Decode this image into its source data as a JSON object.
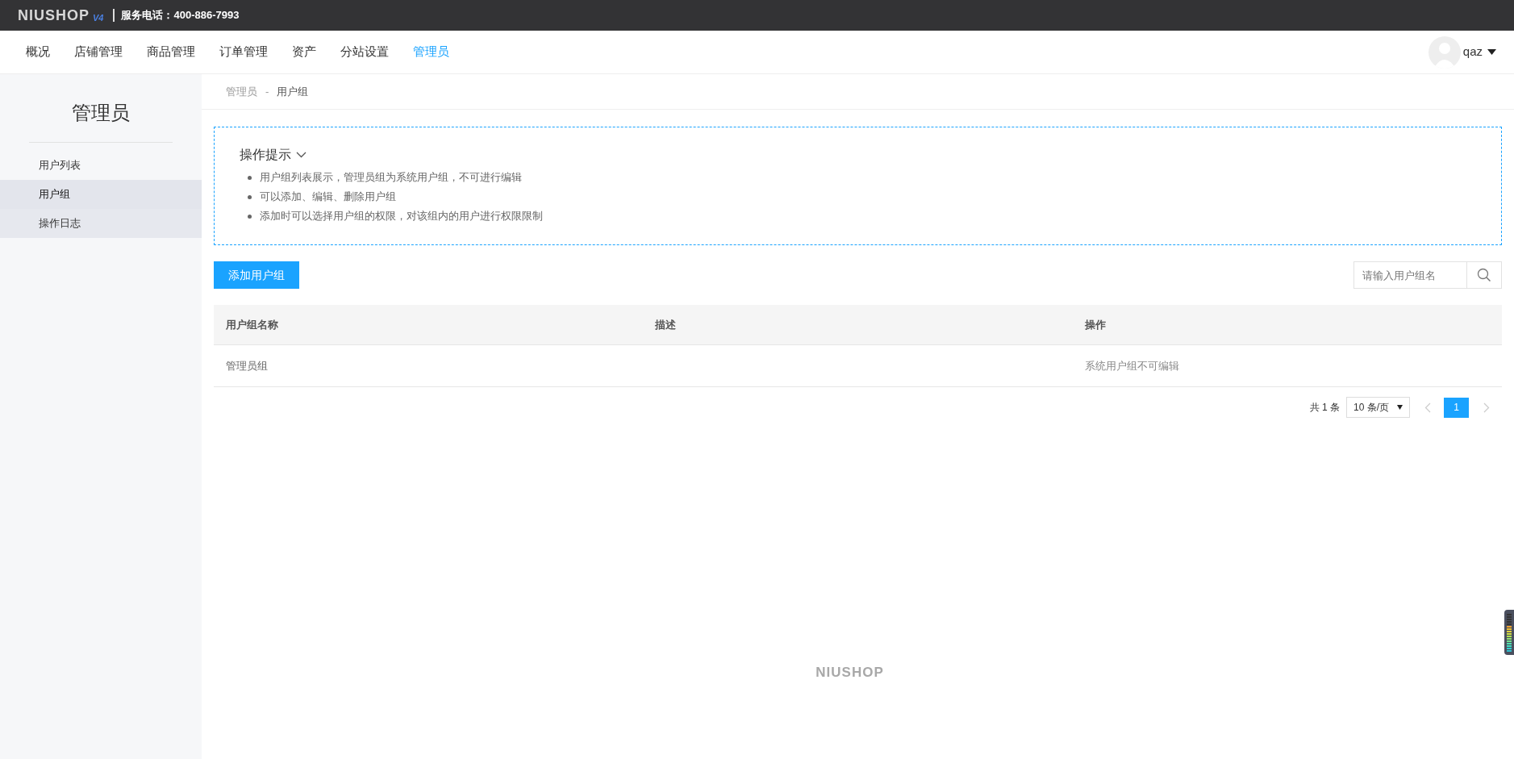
{
  "top_bar": {
    "logo": "NIUSHOP",
    "logo_version": "V4",
    "phone": "服务电话：400-886-7993"
  },
  "nav": {
    "items": [
      {
        "label": "概况",
        "selected": false
      },
      {
        "label": "店铺管理",
        "selected": false
      },
      {
        "label": "商品管理",
        "selected": false
      },
      {
        "label": "订单管理",
        "selected": false
      },
      {
        "label": "资产",
        "selected": false
      },
      {
        "label": "分站设置",
        "selected": false
      },
      {
        "label": "管理员",
        "selected": true
      }
    ],
    "user": "qaz"
  },
  "sidebar": {
    "title": "管理员",
    "items": [
      {
        "label": "用户列表",
        "selected": false,
        "hovered": false
      },
      {
        "label": "用户组",
        "selected": true,
        "hovered": false
      },
      {
        "label": "操作日志",
        "selected": false,
        "hovered": true
      }
    ]
  },
  "breadcrumb": {
    "items": [
      "管理员",
      "用户组"
    ],
    "separator": "-"
  },
  "tips": {
    "title": "操作提示",
    "items": [
      "用户组列表展示，管理员组为系统用户组，不可进行编辑",
      "可以添加、编辑、删除用户组",
      "添加时可以选择用户组的权限，对该组内的用户进行权限限制"
    ]
  },
  "add_button": "添加用户组",
  "search": {
    "placeholder": "请输入用户组名"
  },
  "table": {
    "columns": [
      "用户组名称",
      "描述",
      "操作"
    ],
    "rows": [
      [
        "管理员组",
        "",
        "系统用户组不可编辑"
      ]
    ]
  },
  "pagination": {
    "total": "共 1 条",
    "page_size": "10 条/页",
    "pages": [
      {
        "label": "1",
        "selected": true
      }
    ]
  },
  "footer": "NIUSHOP"
}
